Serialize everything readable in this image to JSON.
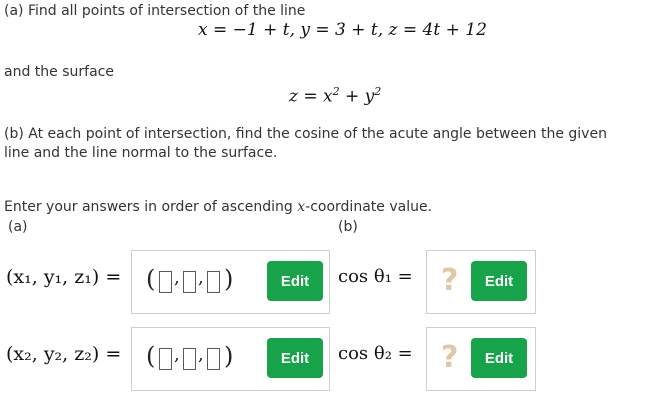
{
  "part_a": {
    "prompt": "(a) Find all points of intersection of the line",
    "line_equation": "x = −1 + t, y = 3 + t, z = 4t + 12",
    "surface_intro": "and the surface",
    "surface_equation_lhs": "z = x",
    "surface_equation_mid": " + y",
    "surface_exponent": "2"
  },
  "part_b": {
    "prompt_line1": "(b) At each point of intersection, find the cosine of the acute angle between the given",
    "prompt_line2": "line and the line normal to the surface."
  },
  "instructions": {
    "text_before": "Enter your answers in order of ascending ",
    "variable": "x",
    "text_after": "-coordinate value.",
    "col_a_label": "(a)",
    "col_b_label": "(b)"
  },
  "rows": [
    {
      "point_label": "(x₁, y₁, z₁) =",
      "edit_point_label": "Edit",
      "cos_label": "cos θ₁ =",
      "edit_cos_label": "Edit",
      "placeholder": "?"
    },
    {
      "point_label": "(x₂, y₂, z₂) =",
      "edit_point_label": "Edit",
      "cos_label": "cos θ₂ =",
      "edit_cos_label": "Edit",
      "placeholder": "?"
    }
  ],
  "colors": {
    "edit_button": "#16a34a",
    "placeholder": "#e2c7a7",
    "answer_border": "#cfcfcf"
  }
}
